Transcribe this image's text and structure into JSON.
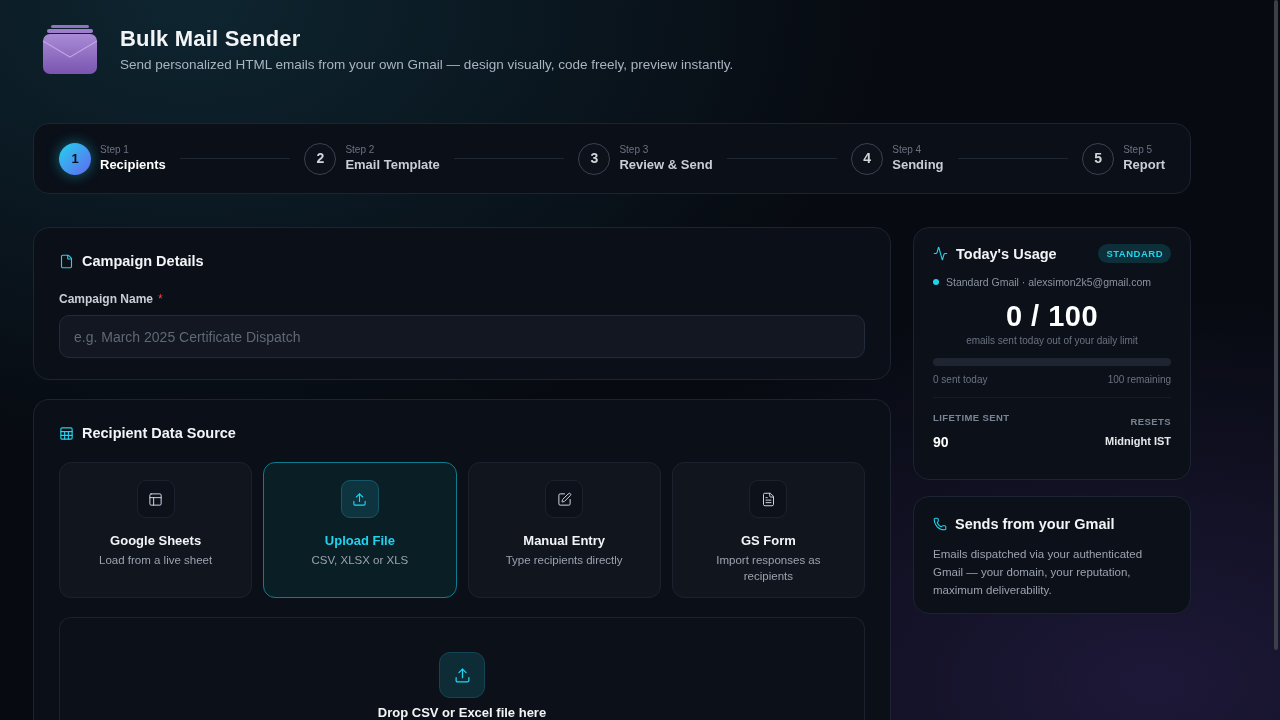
{
  "header": {
    "title": "Bulk Mail Sender",
    "subtitle": "Send personalized HTML emails from your own Gmail — design visually, code freely, preview instantly."
  },
  "steps": [
    {
      "number": "1",
      "step": "Step 1",
      "label": "Recipients",
      "selected": true
    },
    {
      "number": "2",
      "step": "Step 2",
      "label": "Email Template",
      "selected": false
    },
    {
      "number": "3",
      "step": "Step 3",
      "label": "Review & Send",
      "selected": false
    },
    {
      "number": "4",
      "step": "Step 4",
      "label": "Sending",
      "selected": false
    },
    {
      "number": "5",
      "step": "Step 5",
      "label": "Report",
      "selected": false
    }
  ],
  "campaign_details": {
    "title": "Campaign Details",
    "field": {
      "label": "Campaign Name",
      "required_mark": "*",
      "placeholder": "e.g. March 2025 Certificate Dispatch"
    }
  },
  "recipient_source": {
    "title": "Recipient Data Source",
    "options": [
      {
        "kind": "sheets",
        "title": "Google Sheets",
        "description": "Load from a live sheet",
        "selected": false
      },
      {
        "kind": "upload",
        "title": "Upload File",
        "description": "CSV, XLSX or XLS",
        "selected": true
      },
      {
        "kind": "manual",
        "title": "Manual Entry",
        "description": "Type recipients directly",
        "selected": false
      },
      {
        "kind": "form",
        "title": "GS Form",
        "description": "Import responses as recipients",
        "selected": false
      }
    ],
    "dropzone": {
      "text": "Drop CSV or Excel file here"
    }
  },
  "usage": {
    "title": "Today's Usage",
    "badge": "STANDARD",
    "account": "Standard Gmail · alexsimon2k5@gmail.com",
    "count": "0 / 100",
    "caption": "emails sent today out of your daily limit",
    "progress": {
      "level": 0
    },
    "sent": "0 sent today",
    "remaining": "100 remaining",
    "lifetime": {
      "label": "LIFETIME SENT",
      "value": "90"
    },
    "resets": {
      "label": "RESETS",
      "value": "Midnight IST"
    }
  },
  "gmail_info": {
    "title": "Sends from your Gmail",
    "text": "Emails dispatched via your authenticated Gmail — your domain, your reputation, maximum deliverability."
  }
}
